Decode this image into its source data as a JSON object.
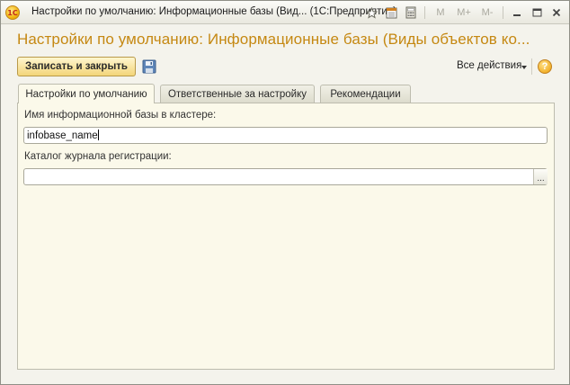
{
  "window": {
    "title": "Настройки по умолчанию: Информационные базы (Вид...  (1С:Предприятие)",
    "logo_text": "1С",
    "memory_buttons": [
      "M",
      "M+",
      "M-"
    ]
  },
  "form": {
    "title": "Настройки по умолчанию: Информационные базы (Виды объектов ко...",
    "save_close_label": "Записать и закрыть",
    "all_actions_label": "Все действия",
    "help_label": "?"
  },
  "tabs": [
    {
      "label": "Настройки по умолчанию",
      "active": true
    },
    {
      "label": "Ответственные за настройку",
      "active": false
    },
    {
      "label": "Рекомендации",
      "active": false
    }
  ],
  "fields": {
    "infobase_name_label": "Имя информационной базы в кластере:",
    "infobase_name_value": "infobase_name",
    "log_dir_label": "Каталог журнала регистрации:",
    "log_dir_value": "",
    "choice_button_label": "..."
  },
  "colors": {
    "accent": "#c58812",
    "button_fill": "#f3d57a",
    "panel_bg": "#fbf9ea",
    "window_bg": "#f4f3ec"
  },
  "icons": [
    "app-logo-icon",
    "star-icon",
    "calendar-icon",
    "calculator-icon",
    "minimize-icon",
    "maximize-icon",
    "close-icon",
    "save-icon",
    "dropdown-caret-icon",
    "help-icon"
  ]
}
